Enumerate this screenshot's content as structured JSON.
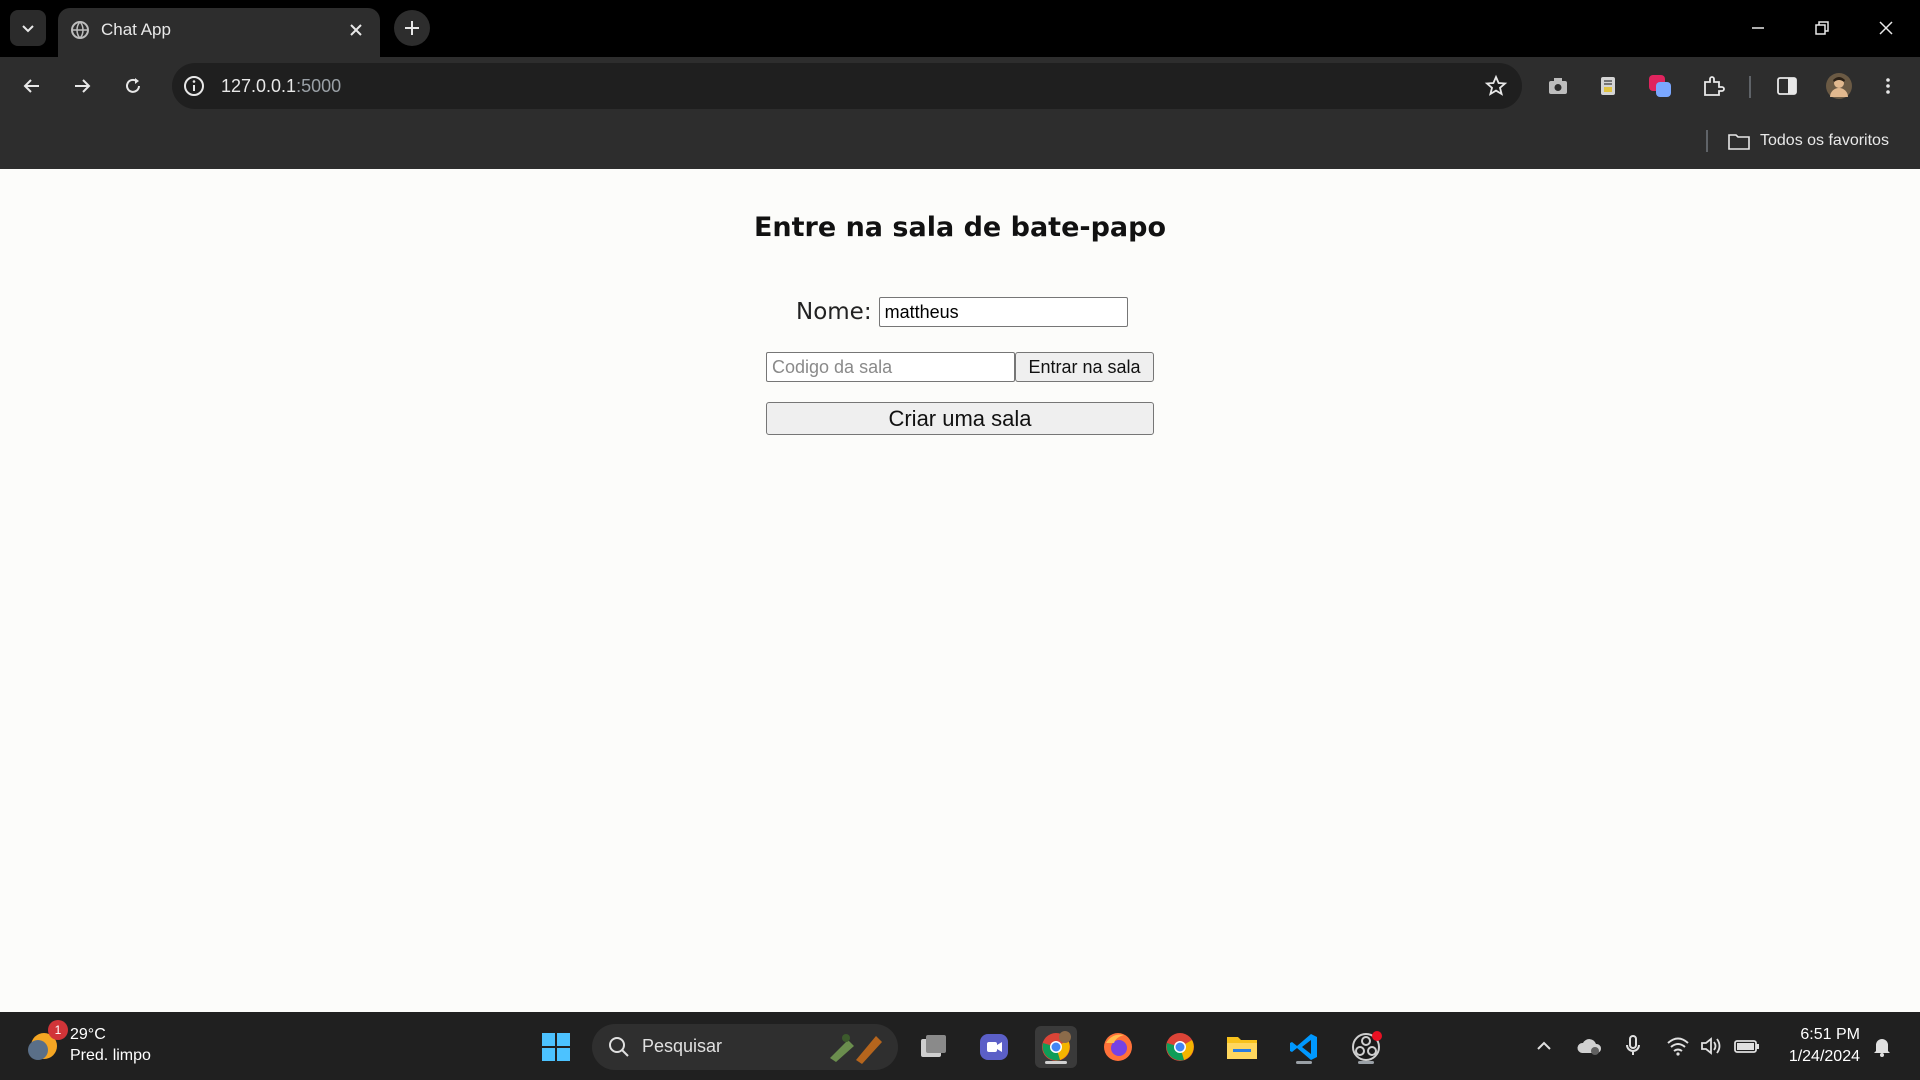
{
  "browser": {
    "tab_title": "Chat App",
    "url_host": "127.0.0.1",
    "url_port": ":5000",
    "bookmarks_all_label": "Todos os favoritos"
  },
  "page": {
    "title": "Entre na sala de bate-papo",
    "name_label": "Nome:",
    "name_value": "mattheus",
    "room_code_placeholder": "Codigo da sala",
    "join_button": "Entrar na sala",
    "create_button": "Criar uma sala"
  },
  "taskbar": {
    "weather_temp": "29°C",
    "weather_desc": "Pred. limpo",
    "weather_badge": "1",
    "search_label": "Pesquisar",
    "time": "6:51 PM",
    "date": "1/24/2024"
  },
  "colors": {
    "chrome_bg": "#2d2d2d",
    "tabstrip_bg": "#000000",
    "page_bg": "#fcfcfa",
    "taskbar_bg": "#202020"
  }
}
